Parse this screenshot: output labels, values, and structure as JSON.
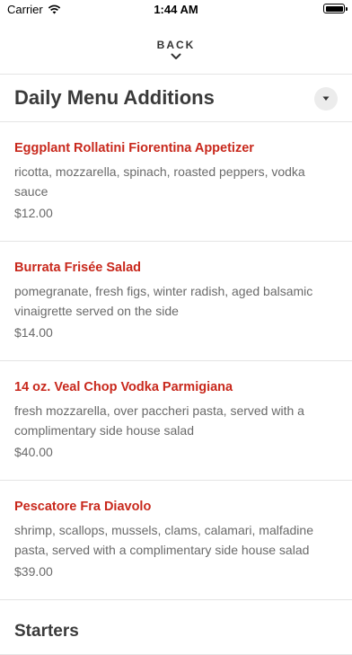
{
  "status_bar": {
    "carrier": "Carrier",
    "time": "1:44 AM",
    "wifi_icon": "wifi-icon",
    "battery_icon": "battery-icon"
  },
  "nav": {
    "back_label": "BACK",
    "back_icon": "chevron-down-icon"
  },
  "section": {
    "title": "Daily Menu Additions",
    "dropdown_icon": "caret-down-icon"
  },
  "items": [
    {
      "name": "Eggplant Rollatini Fiorentina Appetizer",
      "description": "ricotta, mozzarella, spinach, roasted peppers, vodka sauce",
      "price": "$12.00"
    },
    {
      "name": "Burrata Frisée Salad",
      "description": "pomegranate, fresh figs, winter radish, aged balsamic vinaigrette served on the side",
      "price": "$14.00"
    },
    {
      "name": "14 oz. Veal Chop Vodka Parmigiana",
      "description": "fresh mozzarella, over paccheri pasta, served with a complimentary side house salad",
      "price": "$40.00"
    },
    {
      "name": "Pescatore Fra Diavolo",
      "description": "shrimp, scallops, mussels, clams, calamari, malfadine pasta, served with a complimentary side house salad",
      "price": "$39.00"
    }
  ],
  "next_section": {
    "title": "Starters"
  },
  "colors": {
    "item_name": "#c8281c",
    "text_muted": "#6a6a6a",
    "divider": "#e4e4e4"
  }
}
